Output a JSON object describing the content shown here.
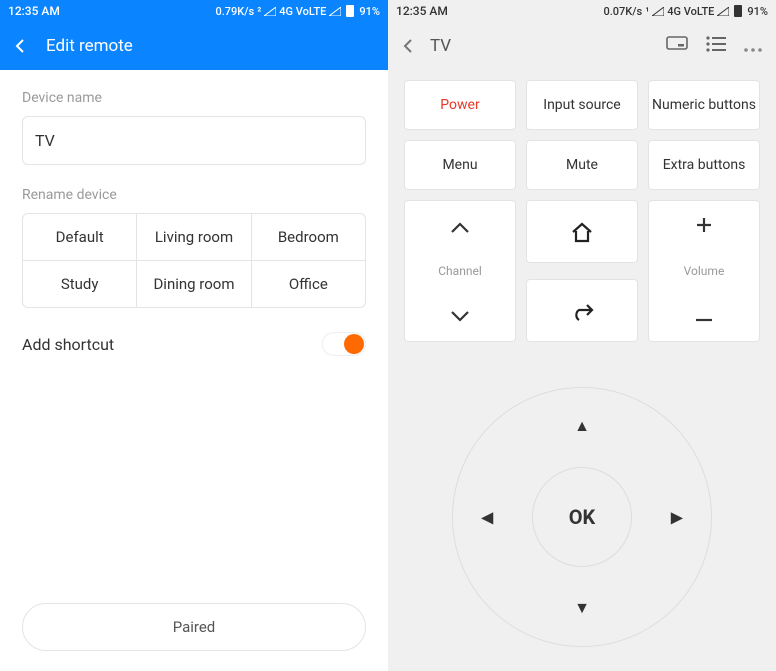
{
  "left": {
    "status": {
      "time": "12:35 AM",
      "speed": "0.79K/s",
      "net": "4G  VoLTE",
      "battery": "91%"
    },
    "header": {
      "title": "Edit remote"
    },
    "device_name_label": "Device name",
    "device_name_value": "TV",
    "rename_label": "Rename device",
    "rename_options": [
      "Default",
      "Living room",
      "Bedroom",
      "Study",
      "Dining room",
      "Office"
    ],
    "shortcut_label": "Add shortcut",
    "shortcut_on": true,
    "paired_label": "Paired"
  },
  "right": {
    "status": {
      "time": "12:35 AM",
      "speed": "0.07K/s",
      "net": "4G  VoLTE",
      "battery": "91%"
    },
    "header": {
      "title": "TV"
    },
    "buttons": {
      "power": "Power",
      "input": "Input source",
      "numeric": "Numeric buttons",
      "menu": "Menu",
      "mute": "Mute",
      "extra": "Extra buttons"
    },
    "channel_label": "Channel",
    "volume_label": "Volume",
    "ok_label": "OK"
  }
}
